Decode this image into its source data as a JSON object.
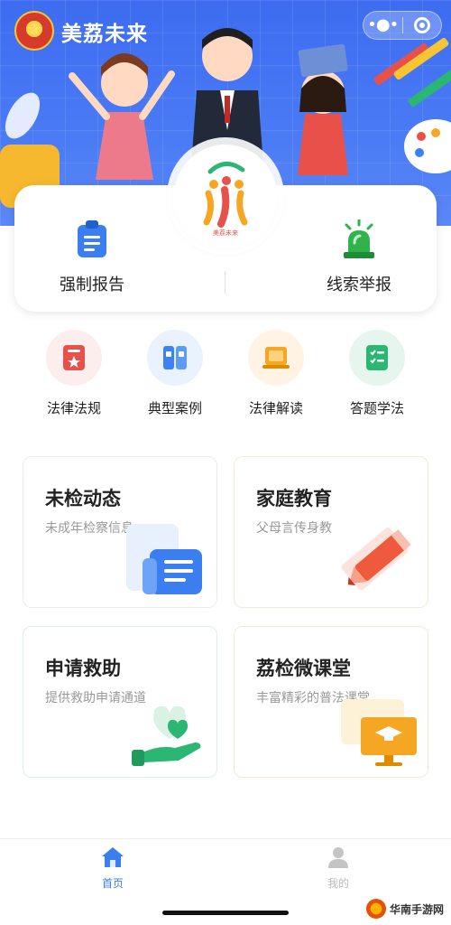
{
  "header": {
    "app_title": "美荔未来",
    "capsule": {
      "more_icon": "more-dots-icon",
      "close_icon": "close-circle-icon"
    }
  },
  "banner": {
    "logo_caption": "美荔未来"
  },
  "primary_actions": [
    {
      "label": "强制报告",
      "icon": "clipboard-icon",
      "color": "#3a7ef0"
    },
    {
      "label": "线索举报",
      "icon": "siren-icon",
      "color": "#2fb34a"
    }
  ],
  "quick_links": [
    {
      "label": "法律法规",
      "icon": "law-book-icon",
      "color": "#e8514a"
    },
    {
      "label": "典型案例",
      "icon": "case-folder-icon",
      "color": "#3b82f6"
    },
    {
      "label": "法律解读",
      "icon": "reading-icon",
      "color": "#f5a623"
    },
    {
      "label": "答题学法",
      "icon": "quiz-icon",
      "color": "#2bb673"
    }
  ],
  "cards": [
    {
      "title": "未检动态",
      "subtitle": "未成年检察信息",
      "icon": "news-icon"
    },
    {
      "title": "家庭教育",
      "subtitle": "父母言传身教",
      "icon": "pencil-icon"
    },
    {
      "title": "申请救助",
      "subtitle": "提供救助申请通道",
      "icon": "heart-hand-icon"
    },
    {
      "title": "荔检微课堂",
      "subtitle": "丰富精彩的普法课堂",
      "icon": "classroom-icon"
    }
  ],
  "tabbar": {
    "items": [
      {
        "label": "首页",
        "icon": "home-icon",
        "active": true,
        "color": "#3a7ef0"
      },
      {
        "label": "我的",
        "icon": "user-icon",
        "active": false,
        "color": "#bbbbbb"
      }
    ]
  },
  "watermark": {
    "text": "华南手游网"
  }
}
